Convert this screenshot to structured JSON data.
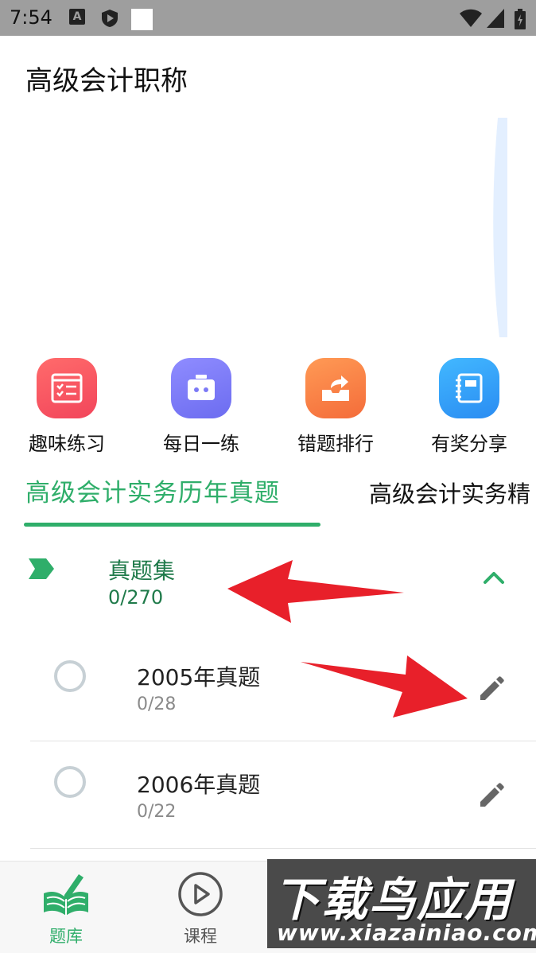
{
  "status_bar": {
    "time": "7:54",
    "badge_letter": "A"
  },
  "header": {
    "title": "高级会计职称"
  },
  "quick_actions": [
    {
      "label": "趣味练习",
      "icon": "checklist-icon",
      "color": "#f2455b"
    },
    {
      "label": "每日一练",
      "icon": "calendar-icon",
      "color": "#6c6cf0"
    },
    {
      "label": "错题排行",
      "icon": "share-box-icon",
      "color": "#f46c3a"
    },
    {
      "label": "有奖分享",
      "icon": "notebook-icon",
      "color": "#2a8cf2"
    }
  ],
  "tabs": [
    {
      "label": "高级会计实务历年真题",
      "active": true
    },
    {
      "label": "高级会计实务精",
      "active": false
    }
  ],
  "group": {
    "title": "真题集",
    "progress": "0/270"
  },
  "items": [
    {
      "title": "2005年真题",
      "progress": "0/28"
    },
    {
      "title": "2006年真题",
      "progress": "0/22"
    }
  ],
  "bottom_nav": [
    {
      "label": "题库",
      "icon": "book-pen-icon",
      "active": true
    },
    {
      "label": "课程",
      "icon": "play-circle-icon",
      "active": false
    }
  ],
  "watermark": {
    "title": "下载鸟应用",
    "url": "www.xiazainiao.com"
  },
  "colors": {
    "accent": "#2fae6a",
    "annotation_arrow": "#e8202a"
  }
}
